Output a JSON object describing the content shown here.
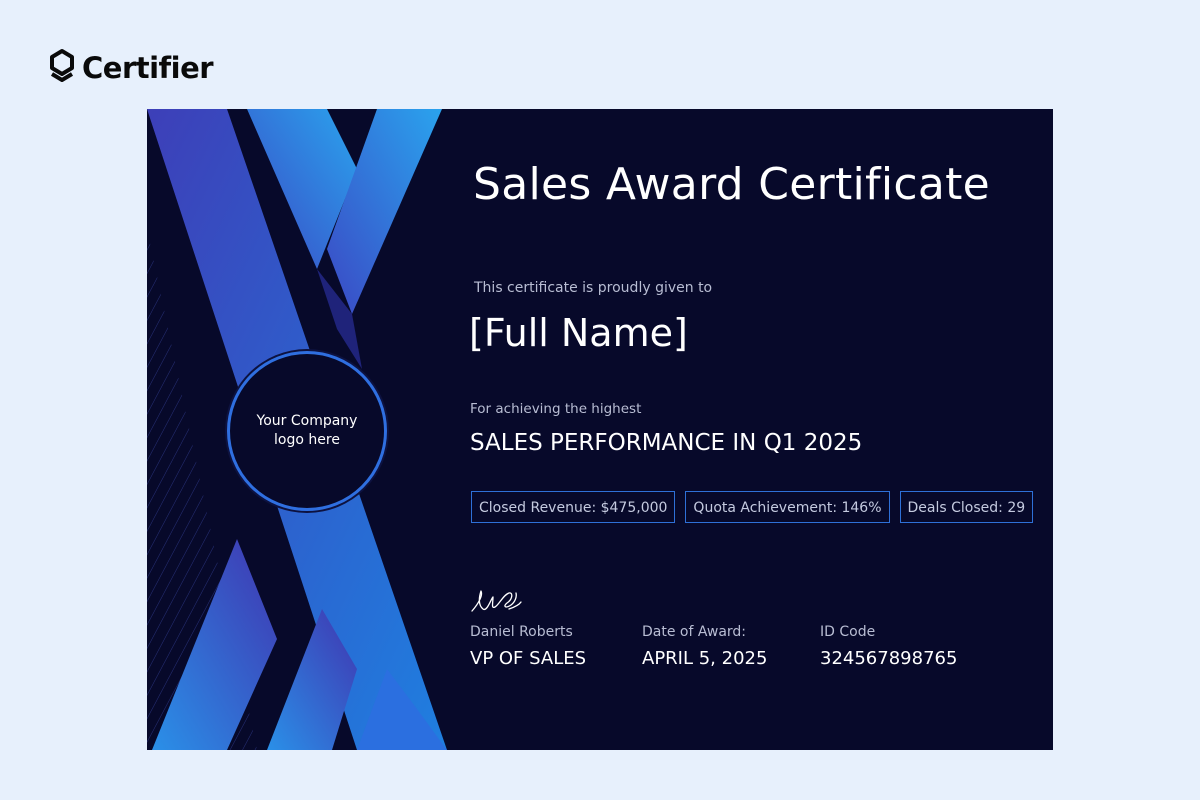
{
  "brand": {
    "name": "Certifier",
    "icon": "certifier-logo-icon"
  },
  "certificate": {
    "title": "Sales Award Certificate",
    "given_text": "This certificate is proudly given to",
    "recipient": "[Full Name]",
    "achievement_intro": "For achieving the highest",
    "achievement": "SALES PERFORMANCE IN Q1 2025",
    "logo_placeholder": "Your Company logo here",
    "stats": [
      {
        "label": "Closed Revenue: $475,000"
      },
      {
        "label": "Quota Achievement: 146%"
      },
      {
        "label": "Deals Closed: 29"
      }
    ],
    "signer": {
      "name": "Daniel Roberts",
      "role": "VP OF SALES"
    },
    "date": {
      "label": "Date of Award:",
      "value": "APRIL 5, 2025"
    },
    "id": {
      "label": "ID Code",
      "value": "324567898765"
    }
  },
  "colors": {
    "page_background": "#e7f0fc",
    "certificate_background": "#07092a",
    "accent_blue": "#2e70d8",
    "ribbon_light": "#2aa3ee",
    "ribbon_dark": "#3d3fb8"
  }
}
